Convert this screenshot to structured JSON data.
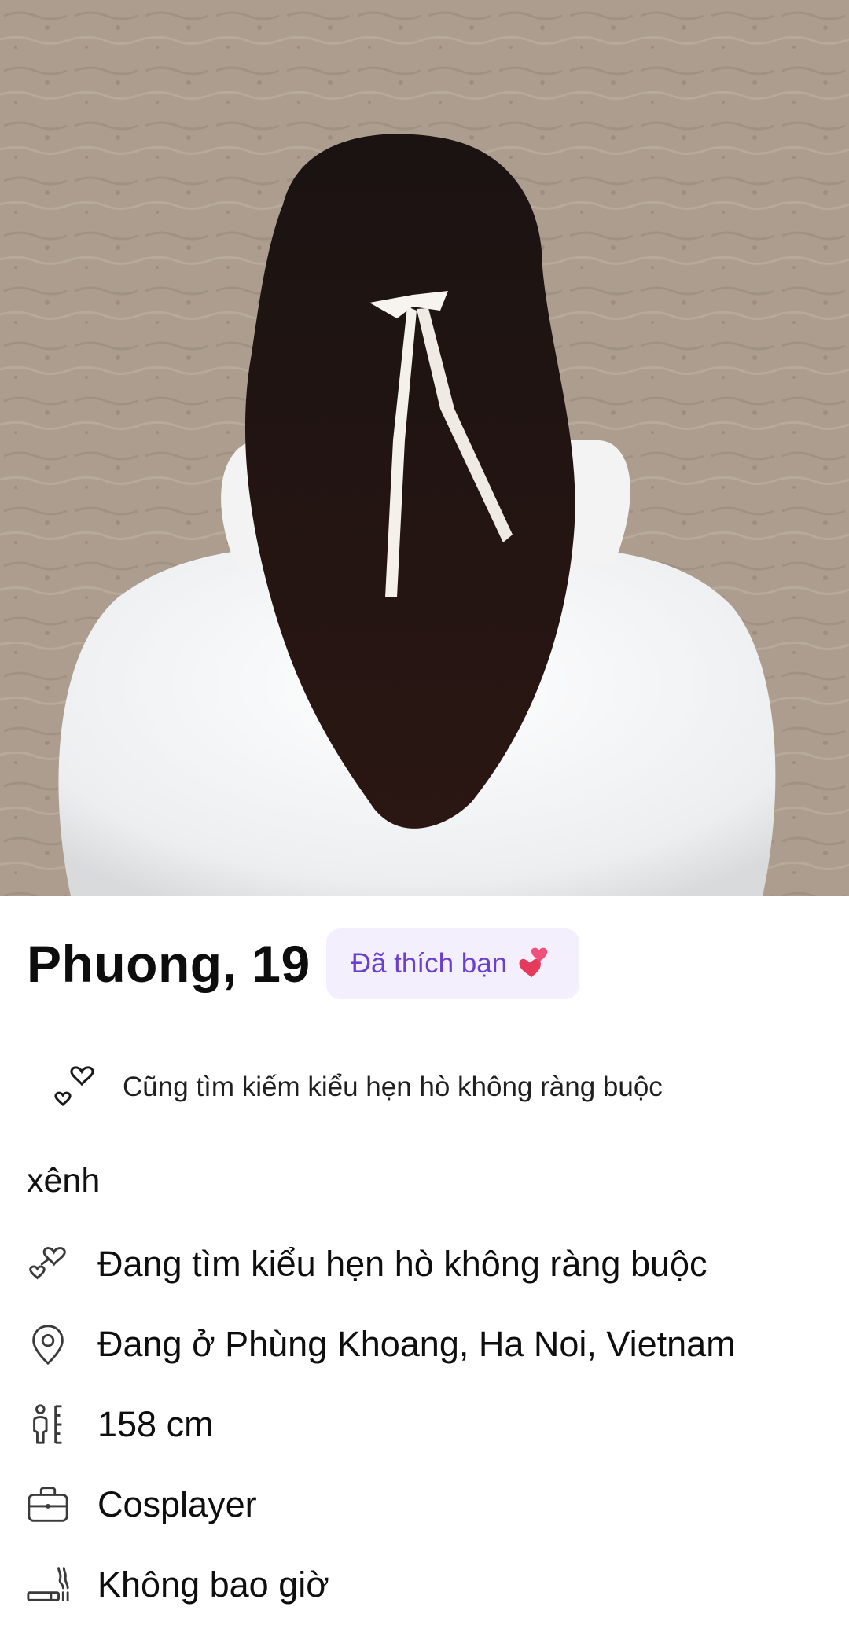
{
  "profile": {
    "name_age": "Phuong, 19",
    "liked_badge": "Đã thích bạn",
    "liked_badge_icon": "two-hearts-icon",
    "shared_looking_for": "Cũng tìm kiếm kiểu hẹn hò không ràng buộc",
    "bio": "xênh"
  },
  "info": {
    "items": [
      {
        "icon": "hearts-outline-icon",
        "text": "Đang tìm kiểu hẹn hò không ràng buộc"
      },
      {
        "icon": "location-pin-icon",
        "text": "Đang ở Phùng Khoang, Ha Noi, Vietnam"
      },
      {
        "icon": "height-ruler-icon",
        "text": "158 cm"
      },
      {
        "icon": "briefcase-icon",
        "text": "Cosplayer"
      },
      {
        "icon": "smoking-icon",
        "text": "Không bao giờ"
      }
    ]
  },
  "colors": {
    "badge_bg": "#f3effd",
    "badge_text": "#6a3fd0",
    "text": "#111111"
  }
}
